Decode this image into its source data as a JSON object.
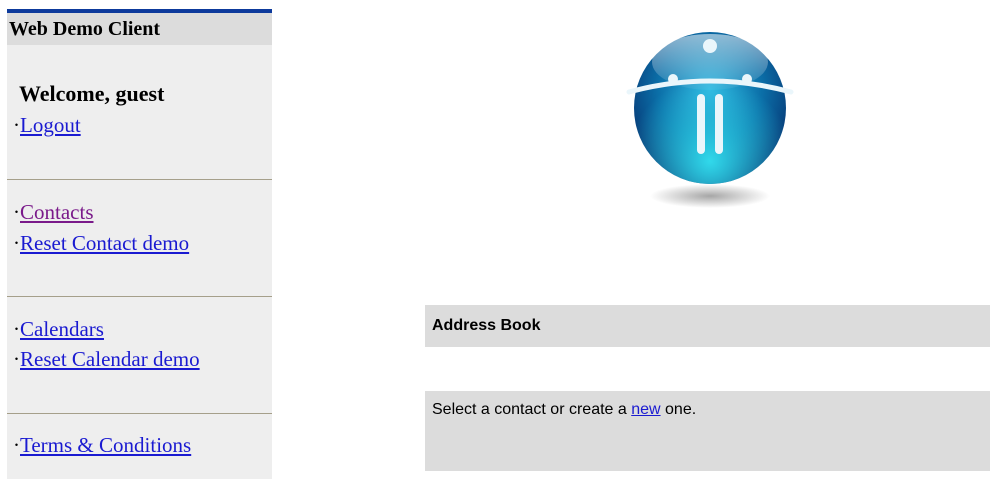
{
  "sidebar": {
    "title": "Web Demo Client",
    "welcome": "Welcome, guest",
    "bullet": "·",
    "logout": "Logout",
    "contacts": "Contacts",
    "reset_contact": "Reset Contact demo",
    "calendars": "Calendars",
    "reset_calendar": "Reset Calendar demo",
    "terms": "Terms & Conditions"
  },
  "logo": {
    "icon": "app-logo-sphere"
  },
  "address_book": {
    "title": "Address Book",
    "message_before": "Select a contact or create a ",
    "new_link": "new",
    "message_after": " one."
  },
  "colors": {
    "header_bar": "#0d3a9c",
    "link": "#1a1ad1",
    "visited_link": "#7a1a8a",
    "panel_bg": "#dcdcdc",
    "sidebar_bg": "#eeeeee"
  }
}
